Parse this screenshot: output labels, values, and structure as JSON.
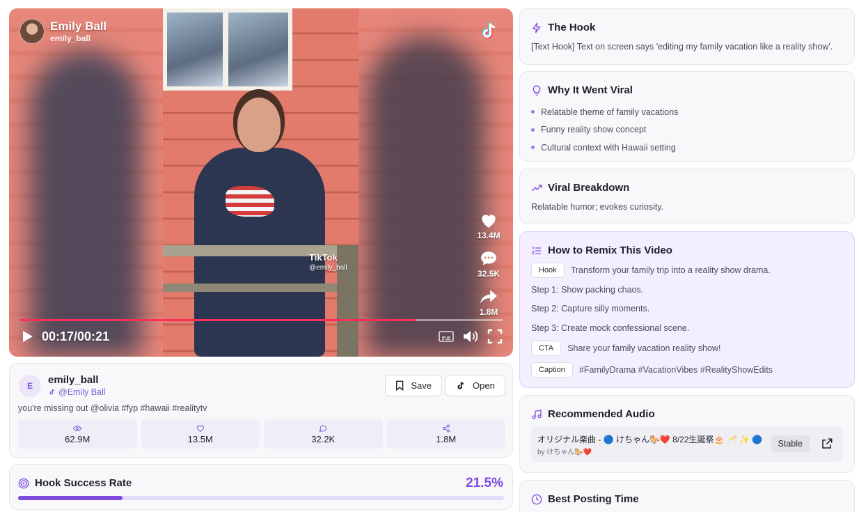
{
  "video": {
    "display_name": "Emily Ball",
    "handle": "emily_ball",
    "watermark_brand": "TikTok",
    "watermark_handle": "@emily_ball",
    "likes": "13.4M",
    "comments": "32.5K",
    "shares": "1.8M",
    "time": "00:17/00:21",
    "progress": 0.82,
    "accent": "#ff2d55"
  },
  "creator": {
    "avatar_initial": "E",
    "username": "emily_ball",
    "tiktok_name": "@Emily Ball",
    "caption": "you're missing out @olivia #fyp #hawaii #realitytv",
    "save_label": "Save",
    "open_label": "Open",
    "stats": [
      {
        "icon": "eye-icon",
        "value": "62.9M"
      },
      {
        "icon": "heart-icon",
        "value": "13.5M"
      },
      {
        "icon": "comment-icon",
        "value": "32.2K"
      },
      {
        "icon": "share-icon",
        "value": "1.8M"
      }
    ]
  },
  "hook_rate": {
    "title": "Hook Success Rate",
    "value": "21.5%",
    "fraction": 0.215,
    "accent": "#7d4be0"
  },
  "hook": {
    "title": "The Hook",
    "text": "[Text Hook] Text on screen says 'editing my family vacation like a reality show'."
  },
  "viral": {
    "title": "Why It Went Viral",
    "reasons": [
      "Relatable theme of family vacations",
      "Funny reality show concept",
      "Cultural context with Hawaii setting"
    ]
  },
  "breakdown": {
    "title": "Viral Breakdown",
    "text": "Relatable humor; evokes curiosity."
  },
  "remix": {
    "title": "How to Remix This Video",
    "hook_tag": "Hook",
    "hook_text": "Transform your family trip into a reality show drama.",
    "steps": [
      "Step 1: Show packing chaos.",
      "Step 2: Capture silly moments.",
      "Step 3: Create mock confessional scene."
    ],
    "cta_tag": "CTA",
    "cta_text": "Share your family vacation reality show!",
    "caption_tag": "Caption",
    "caption_text": "#FamilyDrama #VacationVibes #RealityShowEdits"
  },
  "audio": {
    "title": "Recommended Audio",
    "track": "オリジナル楽曲 - 🔵 けちゃん🐎❤️ 8/22生誕祭🎂 🥂 ✨ 🔵",
    "by": "by けちゃん🐎❤️",
    "status": "Stable"
  },
  "posting": {
    "title": "Best Posting Time"
  }
}
